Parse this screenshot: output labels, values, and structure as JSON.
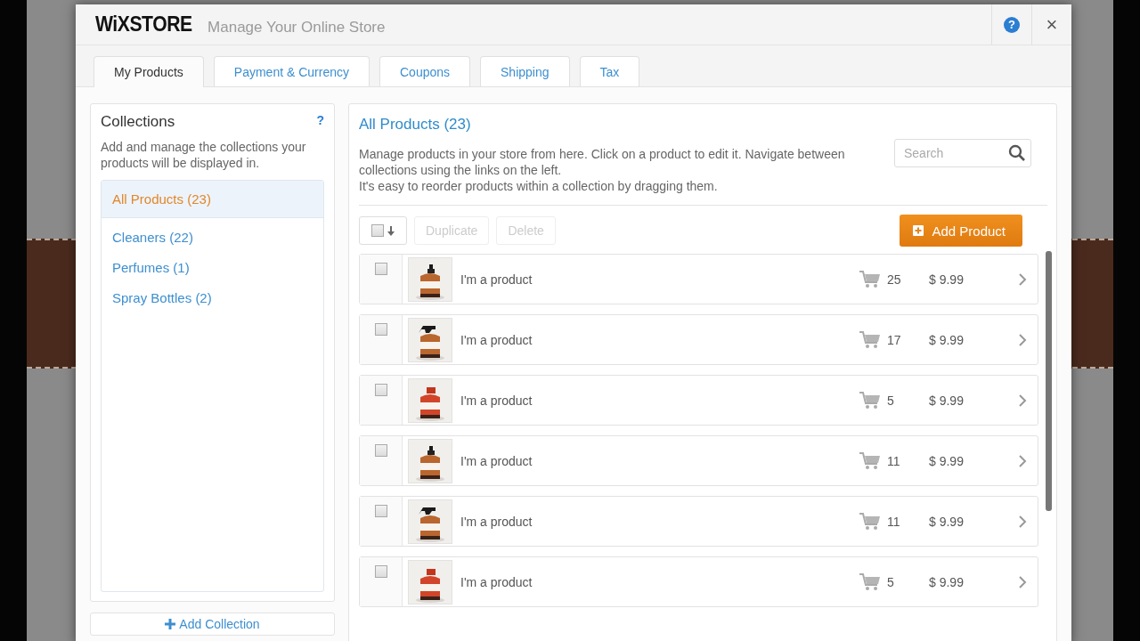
{
  "header": {
    "logo": "WiXSTORE",
    "subtitle": "Manage Your Online Store",
    "help": "?",
    "close": "×"
  },
  "tabs": [
    {
      "label": "My Products",
      "selected": true
    },
    {
      "label": "Payment & Currency",
      "selected": false
    },
    {
      "label": "Coupons",
      "selected": false
    },
    {
      "label": "Shipping",
      "selected": false
    },
    {
      "label": "Tax",
      "selected": false
    }
  ],
  "collections": {
    "title": "Collections",
    "help": "?",
    "description": "Add and manage the collections your products will be displayed in.",
    "items": [
      {
        "label": "All Products (23)",
        "selected": true
      },
      {
        "label": "Cleaners (22)",
        "selected": false
      },
      {
        "label": "Perfumes (1)",
        "selected": false
      },
      {
        "label": "Spray Bottles (2)",
        "selected": false
      }
    ],
    "add_button": "Add Collection"
  },
  "products": {
    "title": "All Products (23)",
    "description": [
      "Manage products in your store from here. Click on a product to edit it. Navigate between collections using the links on the left.",
      "It's easy to reorder products within a collection by dragging them."
    ],
    "search": {
      "placeholder": "Search"
    },
    "select_all": {
      "checked": false
    },
    "actions": [
      {
        "label": "Duplicate",
        "disabled": true
      },
      {
        "label": "Delete",
        "disabled": true
      }
    ],
    "add_button": "Add Product",
    "rows": [
      {
        "checked": false,
        "name": "I'm a product",
        "stock": "25",
        "price": "$ 9.99"
      },
      {
        "checked": false,
        "name": "I'm a product",
        "stock": "17",
        "price": "$ 9.99"
      },
      {
        "checked": false,
        "name": "I'm a product",
        "stock": "5",
        "price": "$ 9.99"
      },
      {
        "checked": false,
        "name": "I'm a product",
        "stock": "11",
        "price": "$ 9.99"
      },
      {
        "checked": false,
        "name": "I'm a product",
        "stock": "11",
        "price": "$ 9.99"
      },
      {
        "checked": false,
        "name": "I'm a product",
        "stock": "5",
        "price": "$ 9.99"
      }
    ]
  }
}
